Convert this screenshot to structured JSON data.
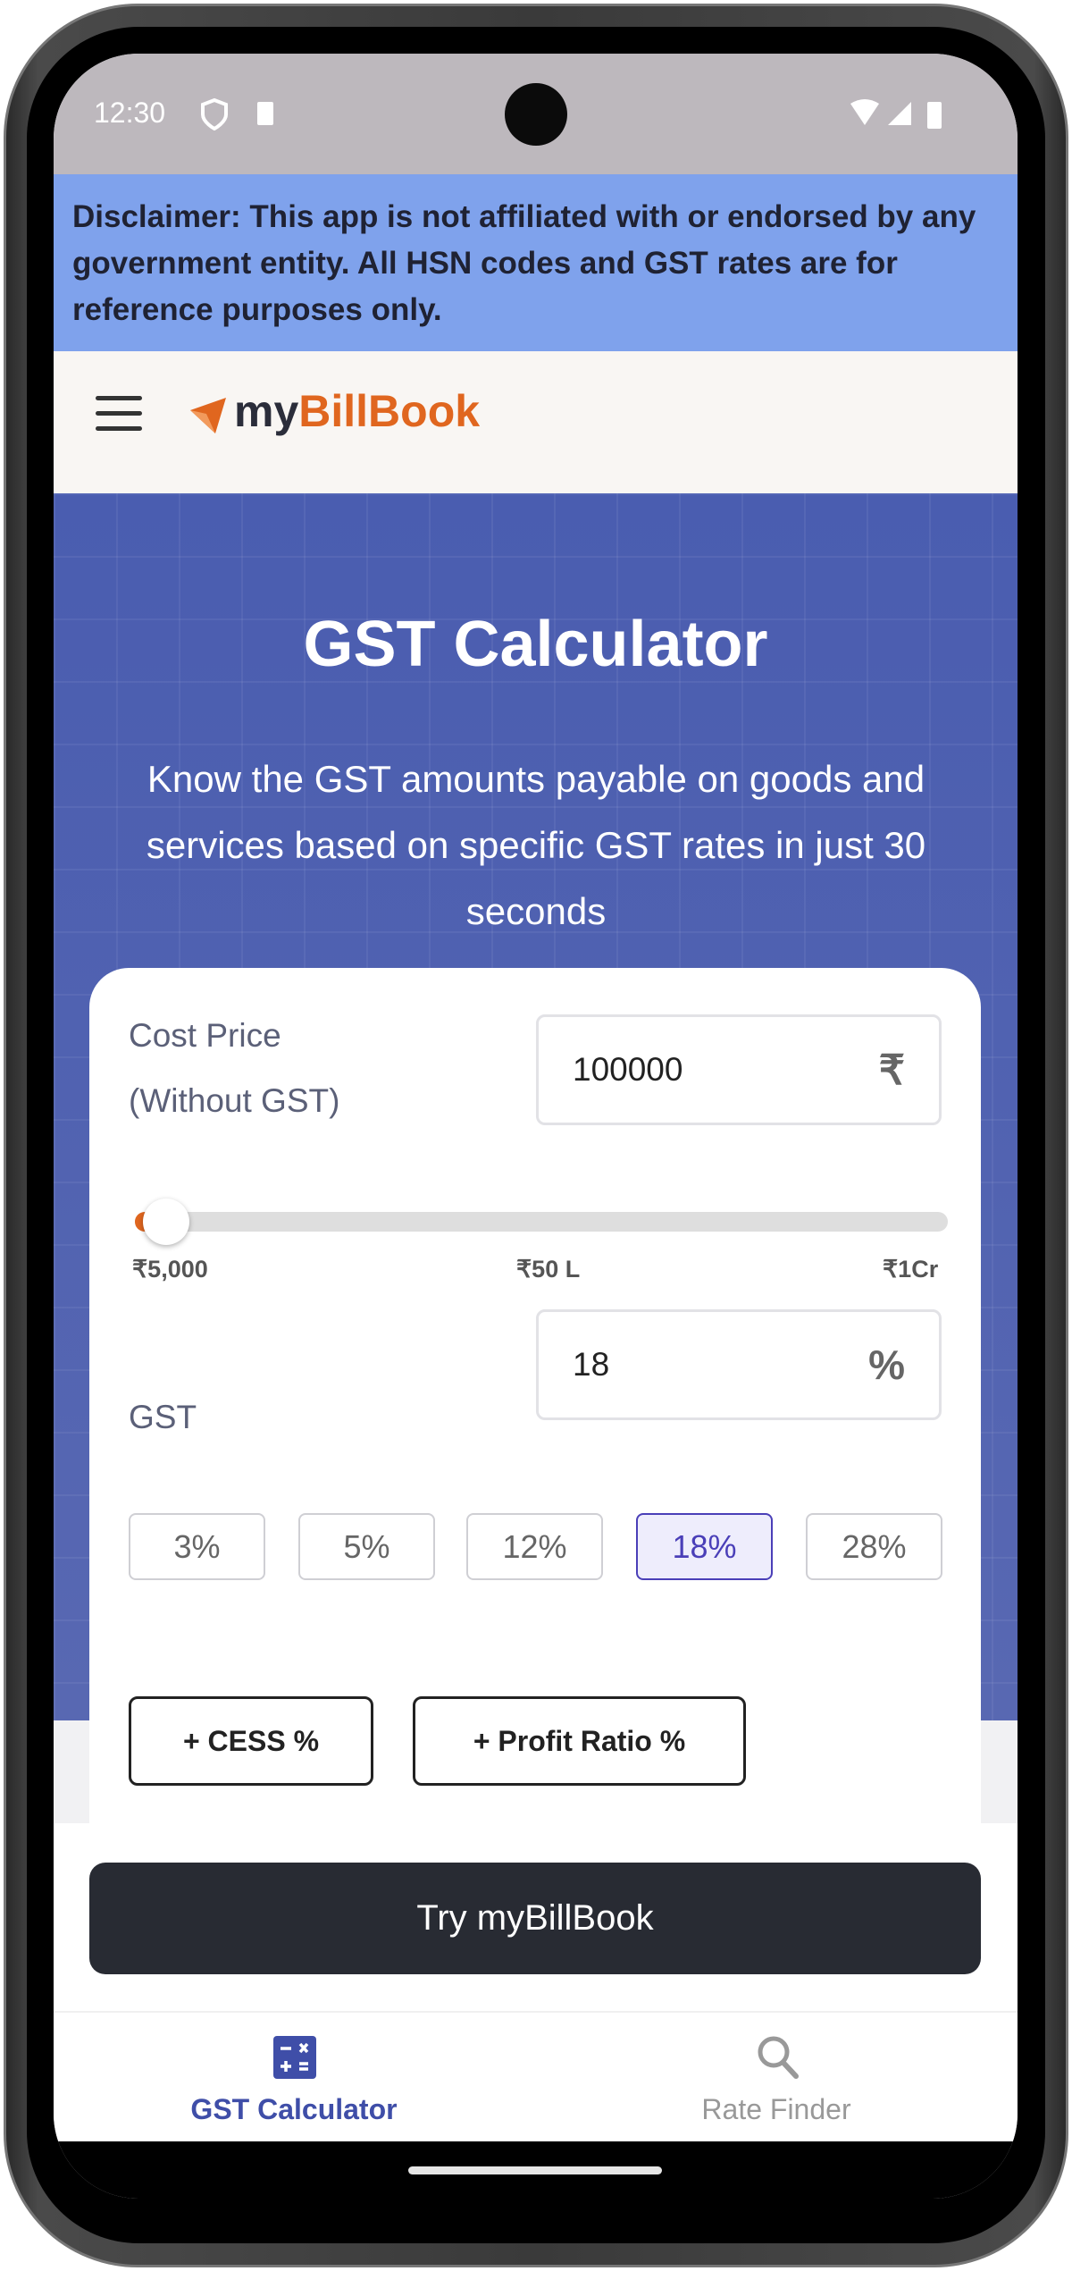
{
  "status_bar": {
    "time": "12:30"
  },
  "disclaimer": "Disclaimer: This app is not affiliated with or endorsed by any government entity. All HSN codes and GST rates are for reference purposes only.",
  "header": {
    "logo_my": "my",
    "logo_billbook": "BillBook"
  },
  "hero": {
    "title": "GST Calculator",
    "subtitle": "Know the GST amounts payable on goods and services based on specific GST rates in just 30 seconds"
  },
  "calculator": {
    "cost_price_label_1": "Cost Price",
    "cost_price_label_2": "(Without GST)",
    "cost_price_value": "100000",
    "currency_symbol": "₹",
    "slider": {
      "min_label": "₹5,000",
      "mid_label": "₹50 L",
      "max_label": "₹1Cr",
      "value": 100000,
      "min": 5000,
      "max": 10000000
    },
    "gst_label": "GST",
    "gst_value": "18",
    "percent_symbol": "%",
    "rates": [
      {
        "label": "3%"
      },
      {
        "label": "5%"
      },
      {
        "label": "12%"
      },
      {
        "label": "18%",
        "selected": true
      },
      {
        "label": "28%"
      }
    ],
    "cess_button": "+ CESS %",
    "profit_button": "+ Profit Ratio %"
  },
  "cta": {
    "label": "Try myBillBook"
  },
  "bottom_nav": [
    {
      "label": "GST Calculator",
      "active": true,
      "icon": "calculator-icon"
    },
    {
      "label": "Rate Finder",
      "active": false,
      "icon": "search-icon"
    }
  ],
  "colors": {
    "accent": "#4a3fb8",
    "hero": "#4a5db0",
    "brand_orange": "#e0661f",
    "nav_active": "#3f4ea8",
    "disclaimer_bg": "#7fa2ec"
  }
}
